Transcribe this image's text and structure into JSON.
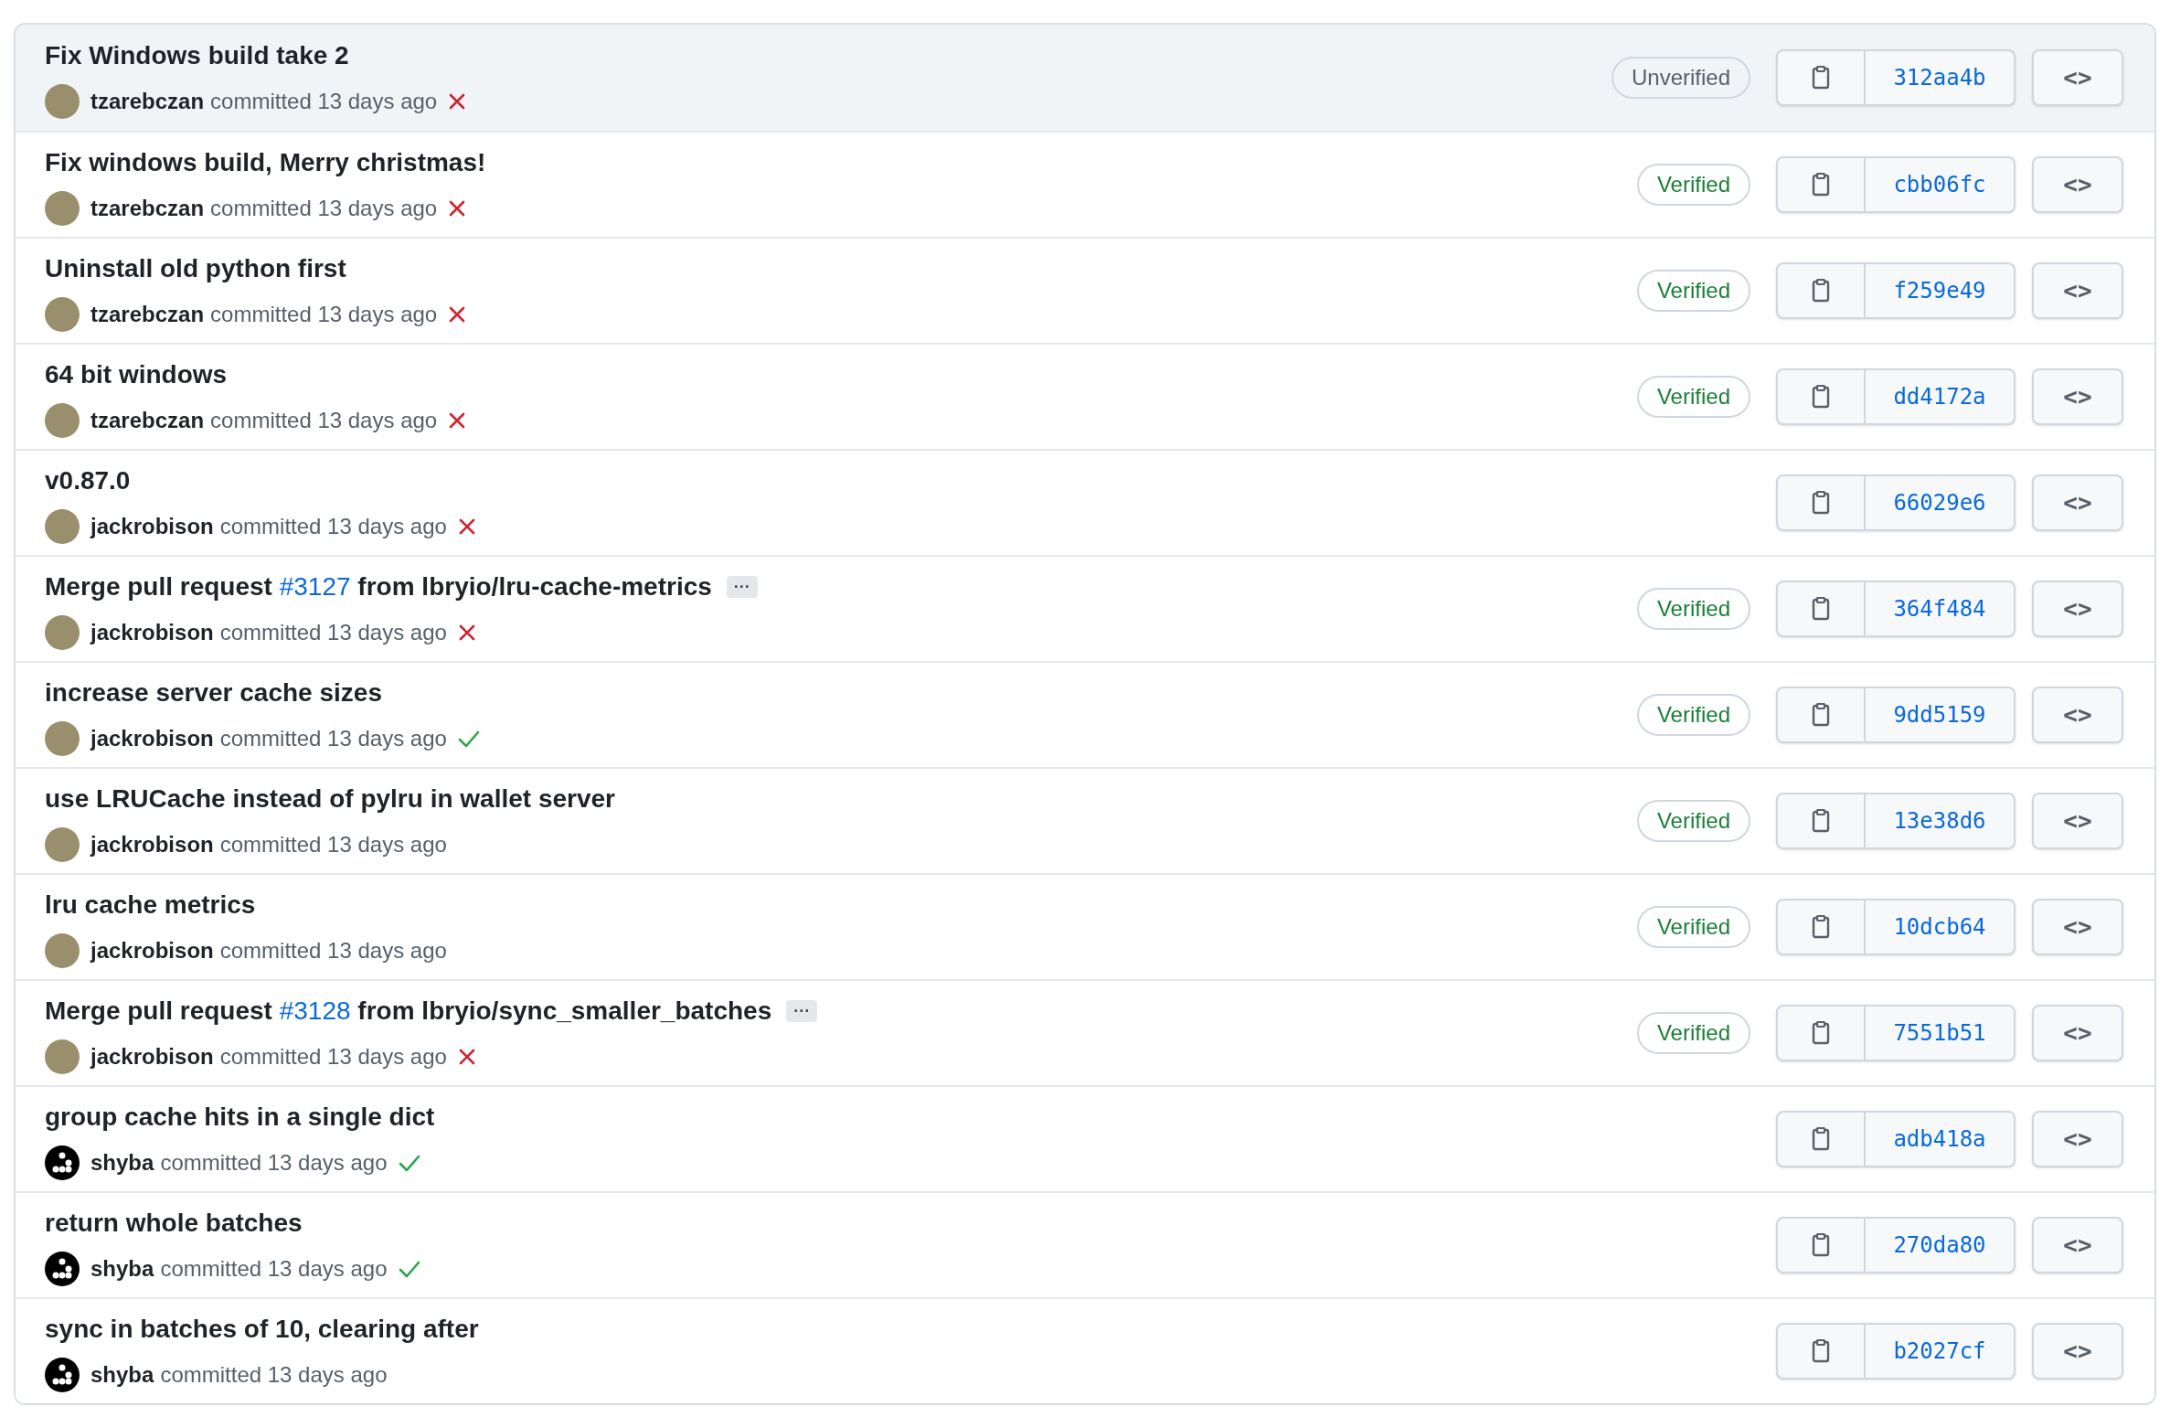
{
  "commits": [
    {
      "selected": true,
      "title": "Fix Windows build take 2",
      "author": "tzarebczan",
      "avatar": {
        "kind": "photo"
      },
      "meta": "committed 13 days ago",
      "check": {
        "kind": "failure"
      },
      "badge": {
        "text": "Unverified",
        "verified": false
      },
      "sha": "312aa4b",
      "browse": "<>"
    },
    {
      "selected": false,
      "title": "Fix windows build, Merry christmas!",
      "author": "tzarebczan",
      "avatar": {
        "kind": "photo"
      },
      "meta": "committed 13 days ago",
      "check": {
        "kind": "failure"
      },
      "badge": {
        "text": "Verified",
        "verified": true
      },
      "sha": "cbb06fc",
      "browse": "<>"
    },
    {
      "selected": false,
      "title": "Uninstall old python first",
      "author": "tzarebczan",
      "avatar": {
        "kind": "photo"
      },
      "meta": "committed 13 days ago",
      "check": {
        "kind": "failure"
      },
      "badge": {
        "text": "Verified",
        "verified": true
      },
      "sha": "f259e49",
      "browse": "<>"
    },
    {
      "selected": false,
      "title": "64 bit windows",
      "author": "tzarebczan",
      "avatar": {
        "kind": "photo"
      },
      "meta": "committed 13 days ago",
      "check": {
        "kind": "failure"
      },
      "badge": {
        "text": "Verified",
        "verified": true
      },
      "sha": "dd4172a",
      "browse": "<>"
    },
    {
      "selected": false,
      "title": "v0.87.0",
      "author": "jackrobison",
      "avatar": {
        "kind": "photo"
      },
      "meta": "committed 13 days ago",
      "check": {
        "kind": "failure"
      },
      "sha": "66029e6",
      "browse": "<>"
    },
    {
      "selected": false,
      "title": "Merge pull request ",
      "link": "#3127",
      "title_after": " from lbryio/lru-cache-metrics",
      "expand": "···",
      "author": "jackrobison",
      "avatar": {
        "kind": "photo"
      },
      "meta": "committed 13 days ago",
      "check": {
        "kind": "failure"
      },
      "badge": {
        "text": "Verified",
        "verified": true
      },
      "sha": "364f484",
      "browse": "<>"
    },
    {
      "selected": false,
      "title": "increase server cache sizes",
      "author": "jackrobison",
      "avatar": {
        "kind": "photo"
      },
      "meta": "committed 13 days ago",
      "check": {
        "kind": "success"
      },
      "badge": {
        "text": "Verified",
        "verified": true
      },
      "sha": "9dd5159",
      "browse": "<>"
    },
    {
      "selected": false,
      "title": "use LRUCache instead of pylru in wallet server",
      "author": "jackrobison",
      "avatar": {
        "kind": "photo"
      },
      "meta": "committed 13 days ago",
      "check": {
        "kind": "none"
      },
      "badge": {
        "text": "Verified",
        "verified": true
      },
      "sha": "13e38d6",
      "browse": "<>"
    },
    {
      "selected": false,
      "title": "lru cache metrics",
      "author": "jackrobison",
      "avatar": {
        "kind": "photo"
      },
      "meta": "committed 13 days ago",
      "check": {
        "kind": "none"
      },
      "badge": {
        "text": "Verified",
        "verified": true
      },
      "sha": "10dcb64",
      "browse": "<>"
    },
    {
      "selected": false,
      "title": "Merge pull request ",
      "link": "#3128",
      "title_after": " from lbryio/sync_smaller_batches",
      "expand": "···",
      "author": "jackrobison",
      "avatar": {
        "kind": "photo"
      },
      "meta": "committed 13 days ago",
      "check": {
        "kind": "failure"
      },
      "badge": {
        "text": "Verified",
        "verified": true
      },
      "sha": "7551b51",
      "browse": "<>"
    },
    {
      "selected": false,
      "title": "group cache hits in a single dict",
      "author": "shyba",
      "avatar": {
        "kind": "identicon"
      },
      "meta": "committed 13 days ago",
      "check": {
        "kind": "success"
      },
      "sha": "adb418a",
      "browse": "<>"
    },
    {
      "selected": false,
      "title": "return whole batches",
      "author": "shyba",
      "avatar": {
        "kind": "identicon"
      },
      "meta": "committed 13 days ago",
      "check": {
        "kind": "success"
      },
      "sha": "270da80",
      "browse": "<>"
    },
    {
      "selected": false,
      "title": "sync in batches of 10, clearing after",
      "author": "shyba",
      "avatar": {
        "kind": "identicon"
      },
      "meta": "committed 13 days ago",
      "check": {
        "kind": "none"
      },
      "sha": "b2027cf",
      "browse": "<>"
    }
  ]
}
